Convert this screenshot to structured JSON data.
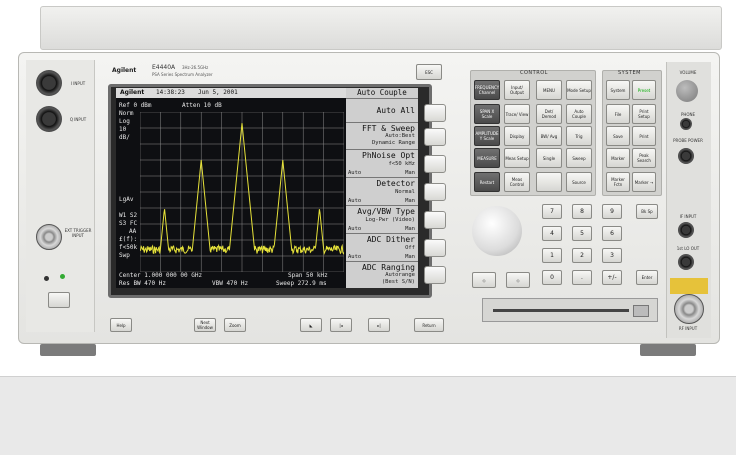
{
  "instrument": {
    "brand": "Agilent",
    "model": "E4440A",
    "model_range": "3Hz-26.5GHz",
    "subtitle": "PSA Series Spectrum Analyzer"
  },
  "screen": {
    "brand": "Agilent",
    "time": "14:38:23",
    "date": "Jun 5, 2001",
    "ref_level": "Ref 0 dBm",
    "atten": "Atten 10 dB",
    "left_labels": [
      "Norm",
      "Log",
      "10",
      "dB/"
    ],
    "lgav": "LgAv",
    "w1s2": "W1  S2",
    "s3fc": "S3  FC",
    "aa": "AA",
    "ff": "£(f):",
    "f50": "f<50k",
    "swp": "Swp",
    "center": "Center 1.000 000 00 GHz",
    "span": "Span 50 kHz",
    "res_bw": "Res BW 470 Hz",
    "vbw": "VBW 470 Hz",
    "sweep": "Sweep 272.9 ms",
    "trace_color": "#e6e23a",
    "grid_color": "#8c8c8c"
  },
  "softkeys": {
    "title": "Auto Couple",
    "items": [
      {
        "label": "Auto All",
        "sub": "",
        "auto": "",
        "man": ""
      },
      {
        "label": "FFT & Sweep",
        "sub": "Auto:Best",
        "sub2": "Dynamic Range",
        "auto": "",
        "man": ""
      },
      {
        "label": "PhNoise Opt",
        "sub": "f<50 kHz",
        "auto": "Auto",
        "man": "Man"
      },
      {
        "label": "Detector",
        "sub": "Normal",
        "auto": "Auto",
        "man": "Man"
      },
      {
        "label": "Avg/VBW Type",
        "sub": "Log-Pwr (Video)",
        "auto": "Auto",
        "man": "Man"
      },
      {
        "label": "ADC Dither",
        "sub": "Off",
        "auto": "Auto",
        "man": "Man"
      },
      {
        "label": "ADC Ranging",
        "sub": "Autorange",
        "sub2": "(Best S/N)",
        "auto": "",
        "man": ""
      }
    ]
  },
  "left_panel": {
    "input1": "I INPUT",
    "input2": "Q INPUT",
    "ext_trigger": "EXT TRIGGER INPUT"
  },
  "bottom_keys": [
    "Help",
    "Next Window",
    "Zoom",
    "Return"
  ],
  "control": {
    "label": "CONTROL",
    "keys": [
      [
        "FREQUENCY Channel",
        "Input/ Output",
        "MENU",
        "Mode Setup"
      ],
      [
        "SPAN X Scale",
        "Trace/ View",
        "Det/ Demod",
        "Auto Couple"
      ],
      [
        "AMPLITUDE Y Scale",
        "Display",
        "BW/ Avg",
        "Trig"
      ],
      [
        "MEASURE",
        "Meas Setup",
        "Single",
        "Sweep"
      ],
      [
        "Restart",
        "Meas Control",
        "",
        "Source"
      ]
    ]
  },
  "system": {
    "label": "SYSTEM",
    "keys": [
      [
        "System",
        "Preset"
      ],
      [
        "File",
        "Print Setup"
      ],
      [
        "Save",
        "Print"
      ],
      [
        "Marker",
        "Peak Search"
      ],
      [
        "Marker Fctn",
        "Marker →"
      ]
    ]
  },
  "right_panel": {
    "volume": "VOLUME",
    "phone": "PHONE",
    "probe_power": "PROBE POWER",
    "if_input": "IF INPUT",
    "lo_out": "1st LO OUT",
    "rf_input": "RF INPUT",
    "esc": "ESC"
  },
  "keypad": {
    "rows": [
      [
        "7",
        "8",
        "9"
      ],
      [
        "4",
        "5",
        "6"
      ],
      [
        "1",
        "2",
        "3"
      ],
      [
        "0",
        ".",
        "+/-"
      ]
    ],
    "bksp": "Bk Sp",
    "enter": "Enter"
  }
}
